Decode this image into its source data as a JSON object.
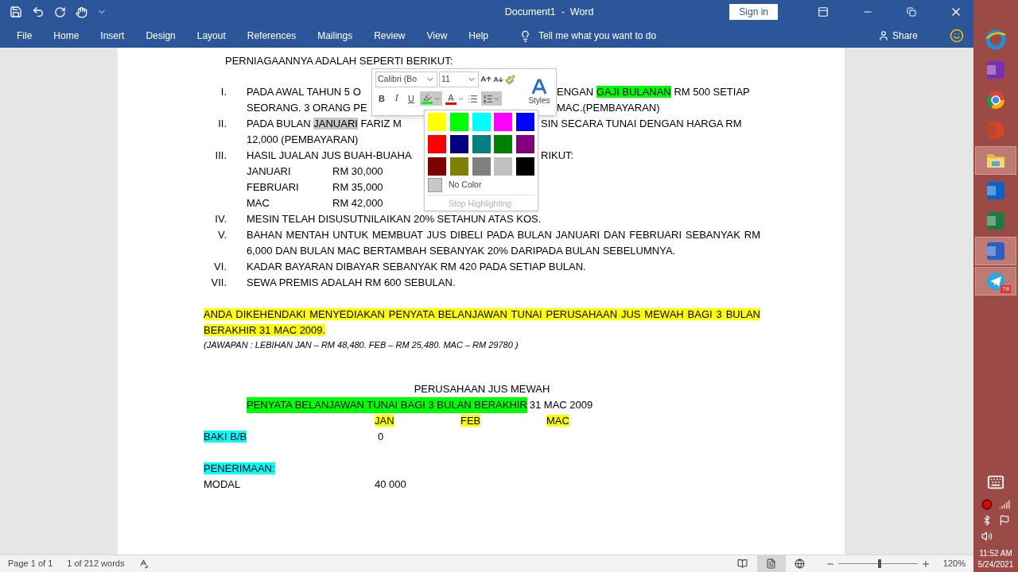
{
  "title_bar": {
    "title": "Document1  -  Word",
    "sign_in": "Sign in"
  },
  "menu": {
    "items": [
      "File",
      "Home",
      "Insert",
      "Design",
      "Layout",
      "References",
      "Mailings",
      "Review",
      "View",
      "Help"
    ],
    "tell_me": "Tell me what you want to do",
    "share": "Share"
  },
  "document": {
    "intro": "PERNIAGAANNYA ADALAH SEPERTI BERIKUT:",
    "list": [
      {
        "numeral": "I.",
        "lines": [
          {
            "left": [
              {
                "text": "PADA AWAL TAHUN 5 O"
              }
            ],
            "right": [
              {
                "text": "ENGAN "
              },
              {
                "text": "GAJI BULANAN",
                "color": "#00ff00"
              },
              {
                "text": " RM 500 SETIAP"
              }
            ]
          },
          {
            "left": [
              {
                "text": "SEORANG. 3 ORANG PE"
              }
            ],
            "right": [
              {
                "text": "MAC.(PEMBAYARAN)"
              }
            ]
          }
        ]
      },
      {
        "numeral": "II.",
        "lines": [
          {
            "left": [
              {
                "text": "PADA BULAN "
              },
              {
                "text": "JANUARI",
                "color": "#c8c8c8"
              },
              {
                "text": " FARIZ M"
              }
            ],
            "right": [
              {
                "text": "SIN SECARA TUNAI DENGAN HARGA RM"
              }
            ]
          },
          {
            "left": [
              {
                "text": "12,000 (PEMBAYARAN)"
              }
            ]
          }
        ]
      },
      {
        "numeral": "III.",
        "lines": [
          {
            "left": [
              {
                "text": "HASIL JUALAN JUS BUAH-BUAHA"
              }
            ],
            "right": [
              {
                "text": "RIKUT:"
              }
            ]
          }
        ],
        "sales": [
          {
            "month": "JANUARI",
            "amount": "RM 30,000"
          },
          {
            "month": "FEBRUARI",
            "amount": "RM 35,000"
          },
          {
            "month": "MAC",
            "amount": "RM 42,000"
          }
        ]
      },
      {
        "numeral": "IV.",
        "text": "MESIN TELAH DISUSUTNILAIKAN 20% SETAHUN ATAS KOS."
      },
      {
        "numeral": "V.",
        "text": "BAHAN MENTAH UNTUK MEMBUAT JUS DIBELI PADA BULAN JANUARI DAN FEBRUARI SEBANYAK RM 6,000 DAN BULAN MAC BERTAMBAH SEBANYAK 20% DARIPADA BULAN SEBELUMNYA."
      },
      {
        "numeral": "VI.",
        "text": "KADAR BAYARAN DIBAYAR SEBANYAK RM 420 PADA SETIAP BULAN."
      },
      {
        "numeral": "VII.",
        "text": "SEWA PREMIS ADALAH RM 600 SEBULAN."
      }
    ],
    "task": {
      "text": "ANDA DIKEHENDAKI MENYEDIAKAN PENYATA BELANJAWAN TUNAI PERUSAHAAN JUS MEWAH BAGI 3 BULAN BERAKHIR 31 MAC 2009.",
      "color": "#ffff00"
    },
    "answer": "(JAWAPAN : LEBIHAN JAN – RM 48,480. FEB – RM 25,480. MAC – RM 29780 )",
    "statement": {
      "company": "PERUSAHAAN JUS MEWAH",
      "title": {
        "text": "PENYATA BELANJAWAN TUNAI BAGI 3 BULAN BERAKHIR",
        "color": "#00ff00"
      },
      "date": "31 MAC 2009",
      "months": [
        {
          "text": "JAN",
          "color": "#ffff00"
        },
        {
          "text": "FEB",
          "color": "#ffff00"
        },
        {
          "text": "MAC",
          "color": "#ffff00"
        }
      ],
      "rows": [
        {
          "label": "BAKI B/B",
          "color": "#00ffff",
          "value": "0"
        },
        {
          "label": "PENERIMAAN:",
          "color": "#00ffff"
        },
        {
          "label": "MODAL",
          "value": "40 000"
        }
      ]
    }
  },
  "mini_toolbar": {
    "font": "Calibri (Bo",
    "size": "11",
    "bold": "B",
    "italic": "I",
    "underline": "U",
    "font_color": {
      "letter": "A",
      "color": "#ff0000"
    },
    "highlight": {
      "color": "#00ff00"
    },
    "numbering_on": true,
    "styles": "Styles"
  },
  "highlight_menu": {
    "colors": [
      {
        "color": "#ffff00"
      },
      {
        "color": "#00ff00"
      },
      {
        "color": "#00ffff"
      },
      {
        "color": "#ff00ff"
      },
      {
        "color": "#0000ff"
      },
      {
        "color": "#ff0000"
      },
      {
        "color": "#000080"
      },
      {
        "color": "#008080"
      },
      {
        "color": "#008000"
      },
      {
        "color": "#800080"
      },
      {
        "color": "#800000"
      },
      {
        "color": "#808000"
      },
      {
        "color": "#808080"
      },
      {
        "color": "#c0c0c0"
      },
      {
        "color": "#000000"
      }
    ],
    "no_color": "No Color",
    "stop": {
      "label": "Stop Highlighting",
      "disabled": true
    }
  },
  "status_bar": {
    "page": "Page 1 of 1",
    "words": "1 of 212 words",
    "views": [
      {
        "kind": "read",
        "selected": false
      },
      {
        "kind": "print",
        "selected": true
      },
      {
        "kind": "web",
        "selected": false
      }
    ],
    "zoom": {
      "level": 0.52,
      "reading": "120%"
    }
  },
  "taskbar": {
    "apps": [
      {
        "kind": "browser",
        "running": false
      },
      {
        "kind": "notes",
        "running": false
      },
      {
        "kind": "globe",
        "running": false
      },
      {
        "kind": "slides",
        "running": false
      },
      {
        "kind": "folder",
        "running": true
      },
      {
        "kind": "mail",
        "running": false
      },
      {
        "kind": "sheet",
        "running": false
      },
      {
        "kind": "doc",
        "running": true
      },
      {
        "kind": "messenger",
        "running": true,
        "badge": "78"
      }
    ],
    "time": "11:52 AM",
    "date": "5/24/2021"
  }
}
